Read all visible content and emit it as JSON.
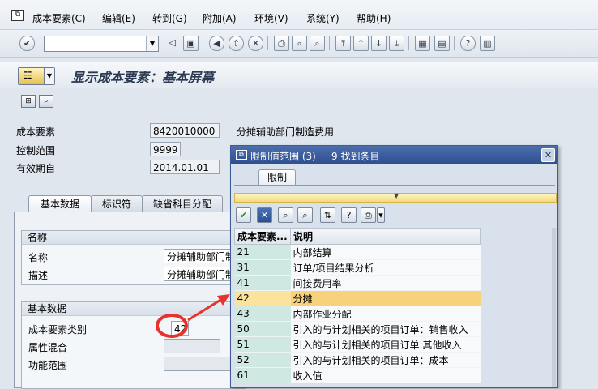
{
  "menubar": {
    "items": [
      "成本要素(C)",
      "编辑(E)",
      "转到(G)",
      "附加(A)",
      "环境(V)",
      "系统(Y)",
      "帮助(H)"
    ]
  },
  "toolbar": {
    "command_value": "",
    "icons": [
      "enter-icon",
      "back-icon",
      "save-icon",
      "back-nav-icon",
      "exit-icon",
      "cancel-icon",
      "print-icon",
      "find-icon",
      "find-next-icon",
      "first-page-icon",
      "prev-page-icon",
      "next-page-icon",
      "last-page-icon",
      "new-session-icon",
      "shortcut-icon",
      "help-icon",
      "layout-icon"
    ]
  },
  "title": {
    "text": "显示成本要素：基本屏幕"
  },
  "header": {
    "cost_element_label": "成本要素",
    "cost_element_value": "8420010000",
    "cost_element_desc": "分摊辅助部门制造费用",
    "controlling_area_label": "控制范围",
    "controlling_area_value": "9999",
    "valid_from_label": "有效期自",
    "valid_from_value": "2014.01.01"
  },
  "tabs": [
    "基本数据",
    "标识符",
    "缺省科目分配"
  ],
  "names_group": {
    "title": "名称",
    "name_label": "名称",
    "name_value": "分摊辅助部门制",
    "desc_label": "描述",
    "desc_value": "分摊辅助部门制"
  },
  "basic_group": {
    "title": "基本数据",
    "category_label": "成本要素类别",
    "category_value": "42",
    "attr_label": "属性混合",
    "attr_value": "",
    "func_label": "功能范围",
    "func_value": ""
  },
  "dialog": {
    "title": "限制值范围 (3)",
    "hits": "9 找到条目",
    "tab_label": "限制",
    "table_headers": [
      "成本要素...",
      "说明"
    ],
    "rows": [
      {
        "key": "21",
        "desc": "内部结算"
      },
      {
        "key": "31",
        "desc": "订单/项目结果分析"
      },
      {
        "key": "41",
        "desc": "间接费用率"
      },
      {
        "key": "42",
        "desc": "分摊",
        "selected": true
      },
      {
        "key": "43",
        "desc": "内部作业分配"
      },
      {
        "key": "50",
        "desc": "引入的与计划相关的项目订单：销售收入"
      },
      {
        "key": "51",
        "desc": "引入的与计划相关的项目订单:其他收入"
      },
      {
        "key": "52",
        "desc": "引入的与计划相关的项目订单：成本"
      },
      {
        "key": "61",
        "desc": "收入值"
      }
    ]
  },
  "colors": {
    "annotation": "#e8322d",
    "selection": "#f7d27a",
    "dialog_title": "#2f4f8f"
  }
}
